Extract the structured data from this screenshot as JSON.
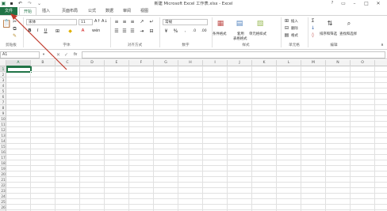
{
  "window": {
    "title": "新建 Microsoft Excel 工作表.xlsx - Excel",
    "help_icon": "help-icon",
    "buttons": [
      "minimize-icon",
      "restore-icon",
      "close-icon"
    ]
  },
  "quick_access": [
    "save-icon",
    "undo-icon",
    "redo-icon",
    "customize-icon"
  ],
  "tabs": [
    {
      "label": "文件"
    },
    {
      "label": "开始"
    },
    {
      "label": "插入"
    },
    {
      "label": "页面布局"
    },
    {
      "label": "公式"
    },
    {
      "label": "数据"
    },
    {
      "label": "审阅"
    },
    {
      "label": "视图"
    }
  ],
  "ribbon": {
    "clipboard": {
      "label": "剪贴板"
    },
    "font": {
      "label": "字体",
      "name": "宋体",
      "size": "11"
    },
    "alignment": {
      "label": "对齐方式"
    },
    "number": {
      "label": "数字",
      "format": "常规"
    },
    "styles": {
      "label": "样式",
      "conditional": "条件格式",
      "table": [
        "套用",
        "表格格式"
      ],
      "cell_styles": "单元格样式"
    },
    "cells": {
      "label": "单元格",
      "insert": "插入",
      "delete": "删除",
      "format": "格式"
    },
    "editing": {
      "label": "编辑",
      "sort": "排序和筛选",
      "find": "查找和选择"
    }
  },
  "formula_bar": {
    "name_box": "A1",
    "fx": "fx",
    "value": ""
  },
  "grid": {
    "columns": [
      "A",
      "B",
      "C",
      "D",
      "E",
      "F",
      "G",
      "H",
      "I",
      "J",
      "K",
      "L",
      "M",
      "N",
      "O"
    ],
    "rows": [
      "1",
      "2",
      "3",
      "4",
      "5",
      "6",
      "7",
      "8",
      "9",
      "10",
      "11",
      "12",
      "13",
      "14",
      "15",
      "16",
      "17",
      "18",
      "19",
      "20",
      "21",
      "22",
      "23",
      "24",
      "25",
      "26"
    ],
    "active_cell": "A1"
  },
  "colors": {
    "accent": "#217346",
    "annotation": "#c0392b"
  }
}
